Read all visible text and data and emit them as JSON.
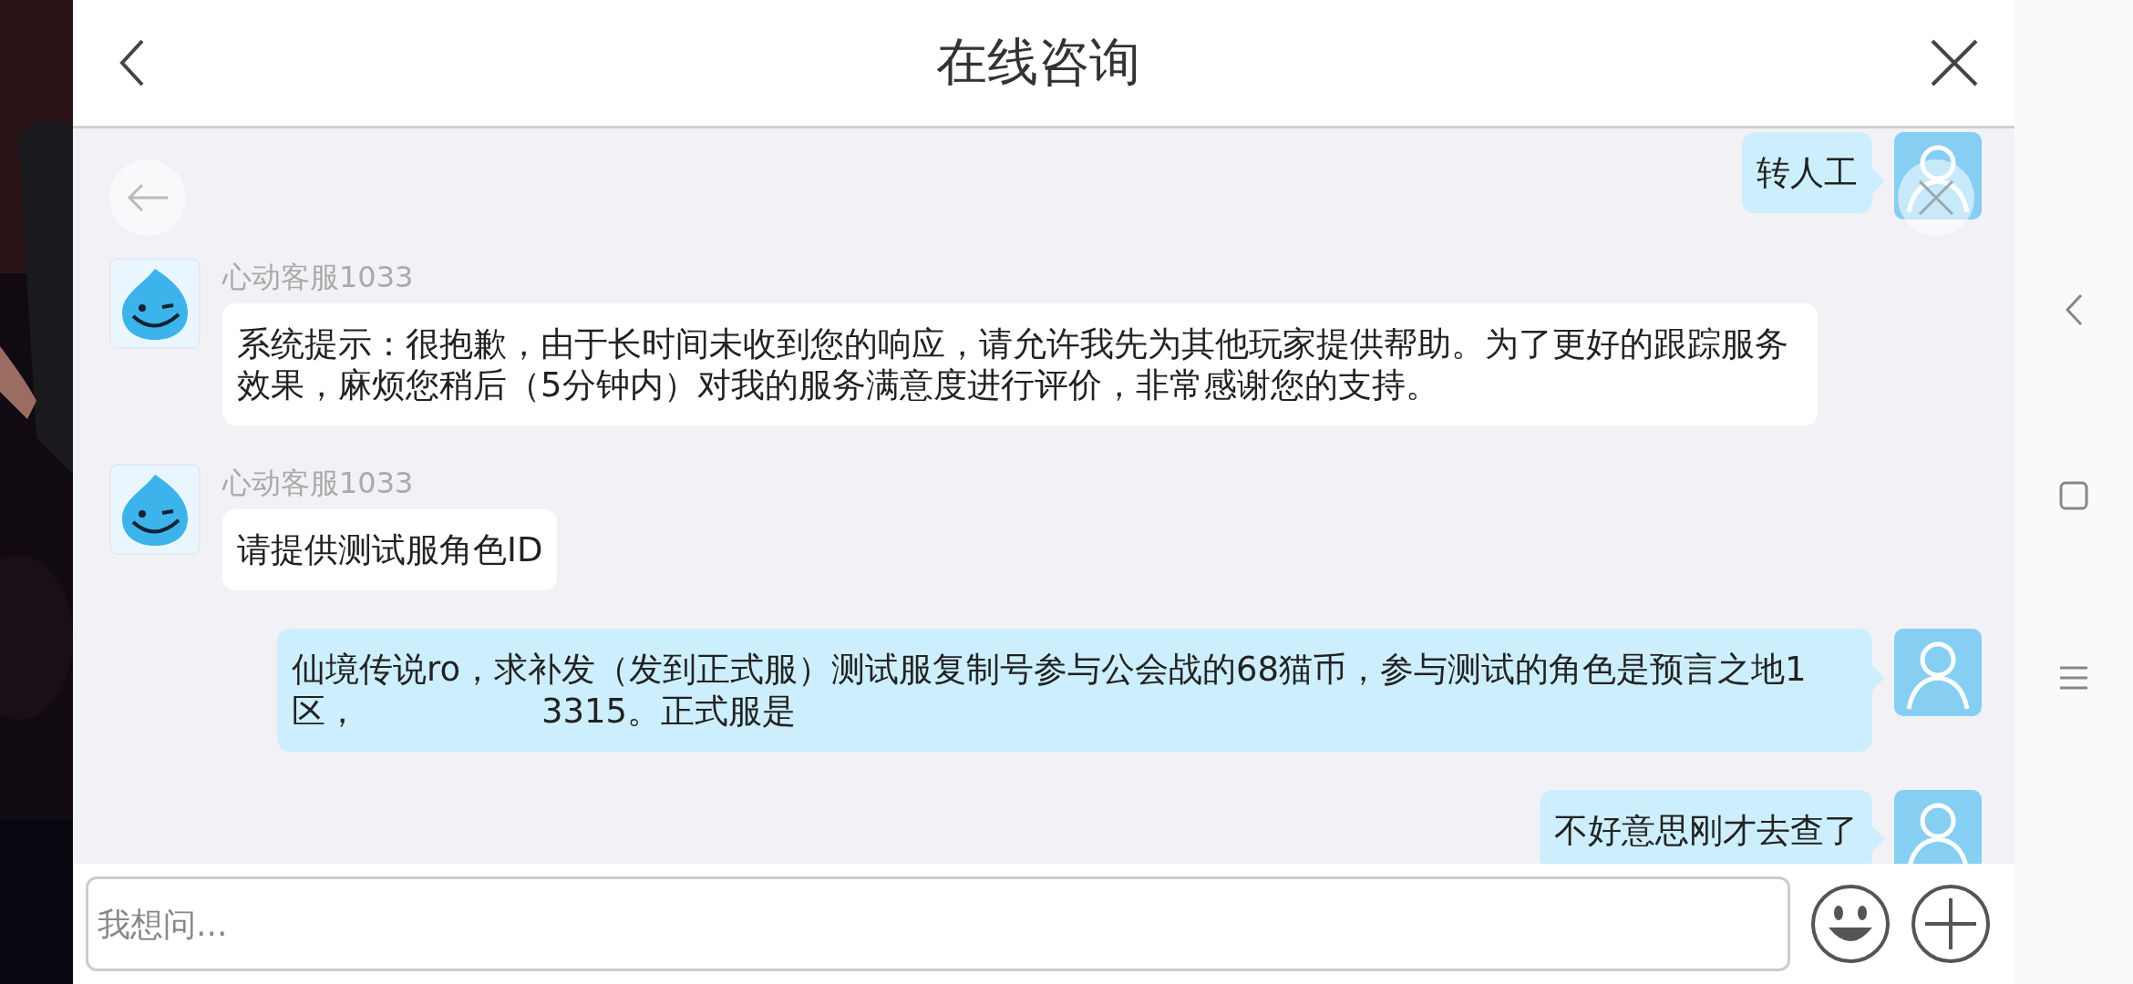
{
  "header": {
    "title": "在线咨询"
  },
  "messages": [
    {
      "outgoing": true,
      "text": "转人工"
    },
    {
      "outgoing": false,
      "sender": "心动客服1033",
      "text": "系统提示：很抱歉，由于长时间未收到您的响应，请允许我先为其他玩家提供帮助。为了更好的跟踪服务效果，麻烦您稍后（5分钟内）对我的服务满意度进行评价，非常感谢您的支持。"
    },
    {
      "outgoing": false,
      "sender": "心动客服1033",
      "text": "请提供测试服角色ID"
    },
    {
      "outgoing": true,
      "parts": [
        "仙境传说ro，求补发（发到正式服）测试服复制号参与公会战的68猫币，参与测试的角色是预言之地1区，",
        "3315。正式服是"
      ]
    },
    {
      "outgoing": true,
      "text": "不好意思刚才去查了"
    }
  ],
  "input": {
    "placeholder": "我想问..."
  }
}
